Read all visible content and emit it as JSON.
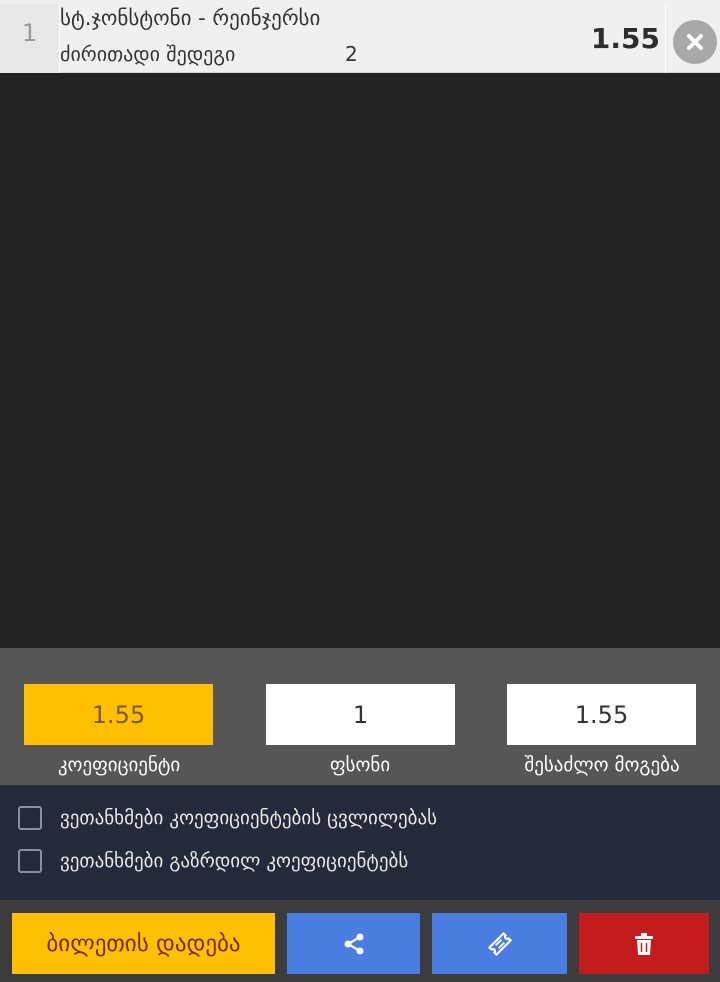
{
  "bet": {
    "index": "1",
    "match": "სტ.ჯონსტონი - რეინჯერსი",
    "market": "ძირითადი შედეგი",
    "pick": "2",
    "odds": "1.55"
  },
  "stake_panel": {
    "odds_value": "1.55",
    "odds_label": "კოეფიციენტი",
    "stake_value": "1",
    "stake_label": "ფსონი",
    "win_value": "1.55",
    "win_label": "შესაძლო მოგება"
  },
  "options": {
    "accept_odds_change": "ვეთანხმები კოეფიციენტების ცვლილებას",
    "accept_boosted_odds": "ვეთანხმები გაზრდილ კოეფიციენტებს"
  },
  "actions": {
    "place_bet": "ბილეთის დადება"
  },
  "colors": {
    "accent_yellow": "#ffc000",
    "action_blue": "#4a7de0",
    "danger_red": "#c41c1c",
    "background_dark": "#232323",
    "options_bg": "#252a3a"
  },
  "icons": {
    "remove": "close-circle-icon",
    "share": "share-icon",
    "ticket": "ticket-icon",
    "delete": "trash-icon"
  }
}
